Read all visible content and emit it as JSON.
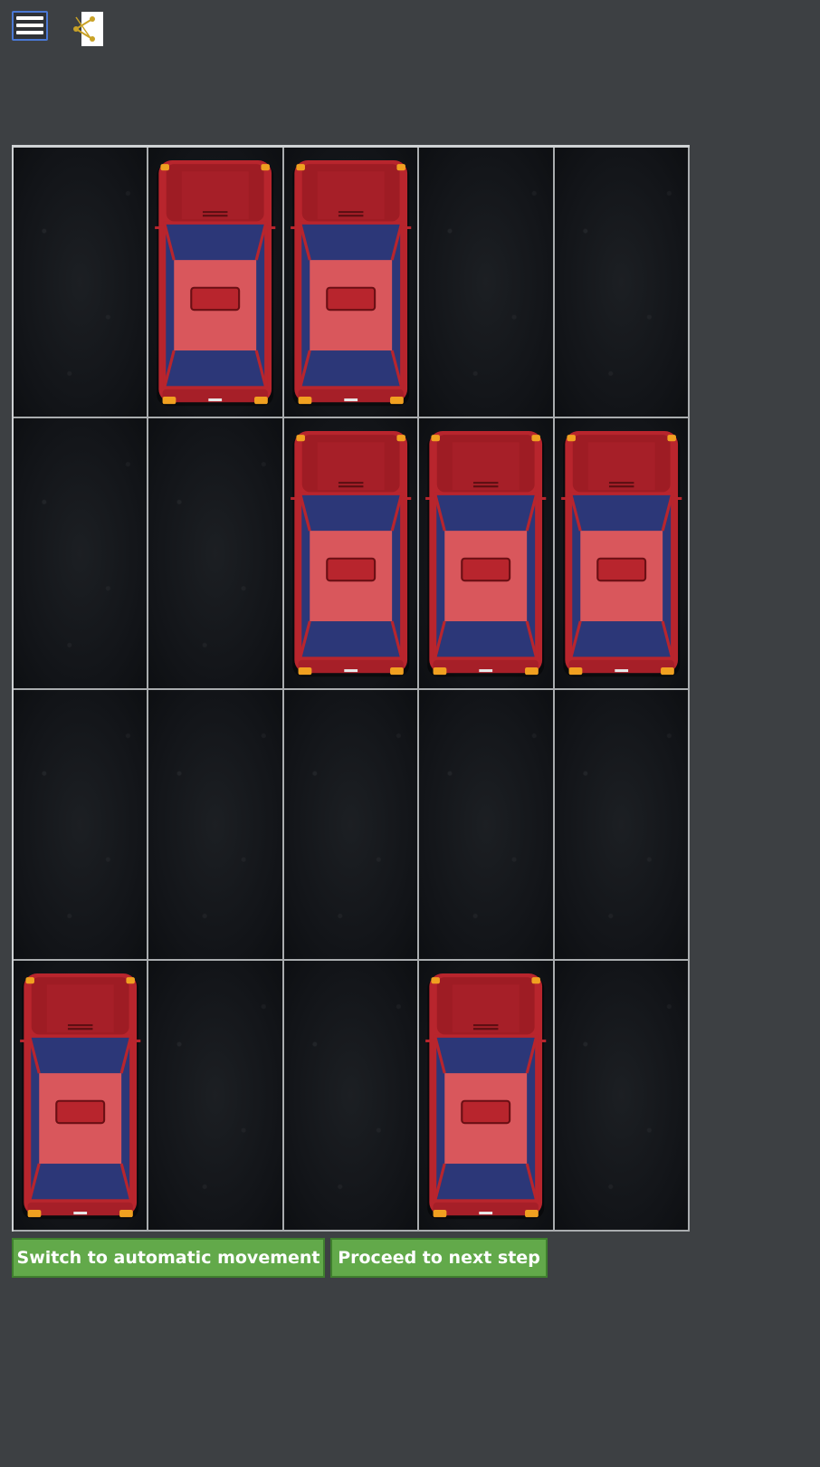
{
  "toolbar": {
    "menu_icon": "hamburger-menu-icon",
    "share_icon": "share-icon"
  },
  "board": {
    "columns": 5,
    "rows": 4,
    "cells": [
      [
        null,
        "car",
        "car",
        null,
        null
      ],
      [
        null,
        null,
        "car",
        "car",
        "car"
      ],
      [
        null,
        null,
        null,
        null,
        null
      ],
      [
        "car",
        null,
        null,
        "car",
        null
      ]
    ]
  },
  "colors": {
    "background": "#3d4043",
    "car_body": "#b8252d",
    "car_cabin": "#2c3778",
    "button": "#62a94a"
  },
  "controls": {
    "auto_label": "Switch to automatic movement",
    "next_label": "Proceed to next step"
  }
}
